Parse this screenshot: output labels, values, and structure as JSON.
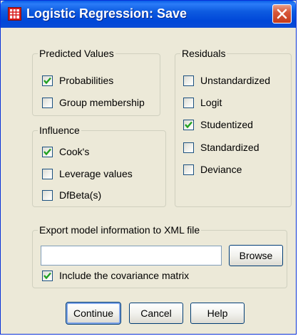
{
  "window": {
    "title": "Logistic Regression: Save"
  },
  "predicted_values": {
    "legend": "Predicted Values",
    "items": [
      {
        "label": "Probabilities",
        "checked": true
      },
      {
        "label": "Group membership",
        "checked": false
      }
    ]
  },
  "influence": {
    "legend": "Influence",
    "items": [
      {
        "label": "Cook's",
        "checked": true
      },
      {
        "label": "Leverage values",
        "checked": false
      },
      {
        "label": "DfBeta(s)",
        "checked": false
      }
    ]
  },
  "residuals": {
    "legend": "Residuals",
    "items": [
      {
        "label": "Unstandardized",
        "checked": false
      },
      {
        "label": "Logit",
        "checked": false
      },
      {
        "label": "Studentized",
        "checked": true
      },
      {
        "label": "Standardized",
        "checked": false
      },
      {
        "label": "Deviance",
        "checked": false
      }
    ]
  },
  "export": {
    "legend": "Export model information to XML file",
    "file_value": "",
    "browse_label": "Browse",
    "covariance": {
      "label": "Include the covariance matrix",
      "checked": true
    }
  },
  "buttons": {
    "continue_label": "Continue",
    "cancel_label": "Cancel",
    "help_label": "Help"
  },
  "colors": {
    "titlebar": "#0054e3",
    "dialog_bg": "#ece9d8",
    "checkmark": "#21a121"
  }
}
